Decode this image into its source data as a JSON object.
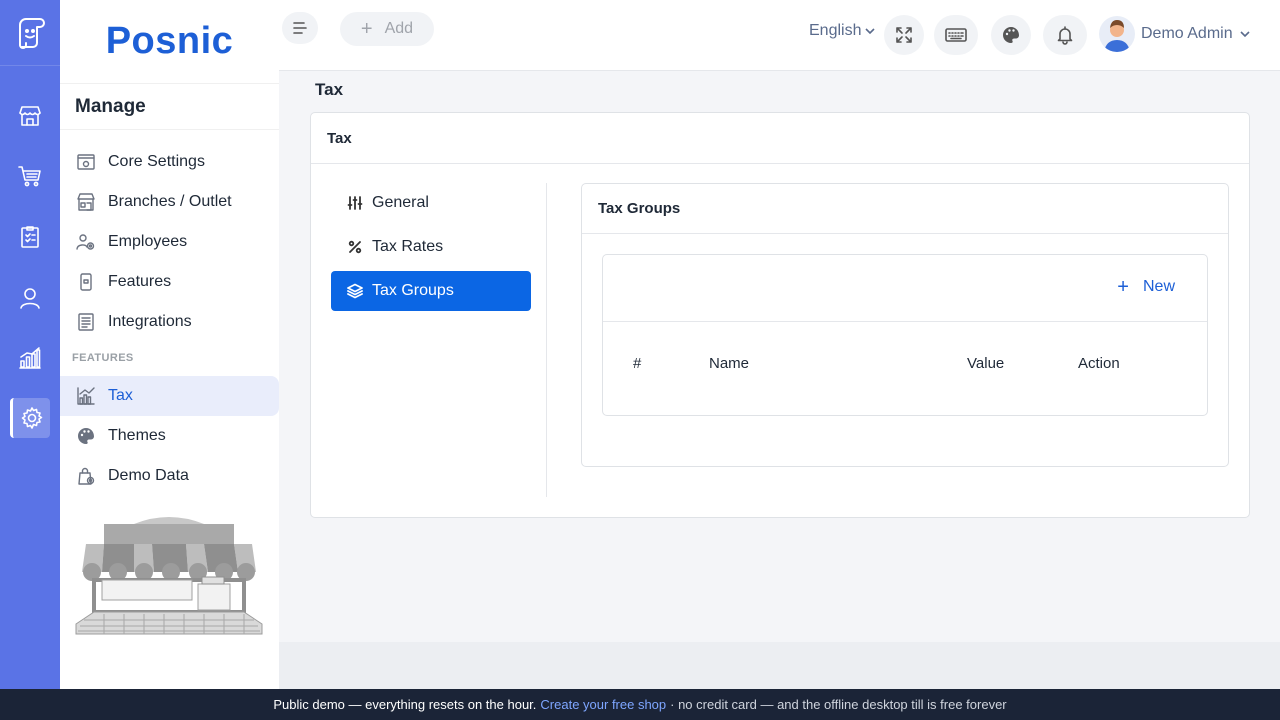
{
  "app": {
    "brand": "Posnic"
  },
  "topbar": {
    "add_label": "Add",
    "language": "English",
    "user_name": "Demo Admin"
  },
  "sidebar": {
    "heading": "Manage",
    "section_label": "FEATURES",
    "items": [
      {
        "label": "Core Settings",
        "icon": "settings-panel-icon"
      },
      {
        "label": "Branches / Outlet",
        "icon": "store-icon"
      },
      {
        "label": "Employees",
        "icon": "employees-gear-icon"
      },
      {
        "label": "Features",
        "icon": "phone-icon"
      },
      {
        "label": "Integrations",
        "icon": "list-icon"
      },
      {
        "label": "Tax",
        "icon": "chart-icon",
        "active": true
      },
      {
        "label": "Themes",
        "icon": "palette-icon"
      },
      {
        "label": "Demo Data",
        "icon": "bag-gear-icon"
      }
    ]
  },
  "page": {
    "title": "Tax",
    "card_title": "Tax",
    "tabs": [
      {
        "label": "General",
        "icon": "sliders-icon"
      },
      {
        "label": "Tax Rates",
        "icon": "percent-icon"
      },
      {
        "label": "Tax Groups",
        "icon": "layers-icon",
        "active": true
      }
    ],
    "panel_title": "Tax Groups",
    "new_label": "New",
    "table_headers": [
      "#",
      "Name",
      "Value",
      "Action"
    ]
  },
  "banner": {
    "text_a": "Public demo — everything resets on the hour.",
    "link": "Create your free shop",
    "text_b": "· no credit card — and the offline desktop till is free forever"
  },
  "colors": {
    "rail": "#5a73e6",
    "brand": "#1d5fd6",
    "active_tab": "#0b66e4",
    "banner": "#1b2437"
  }
}
